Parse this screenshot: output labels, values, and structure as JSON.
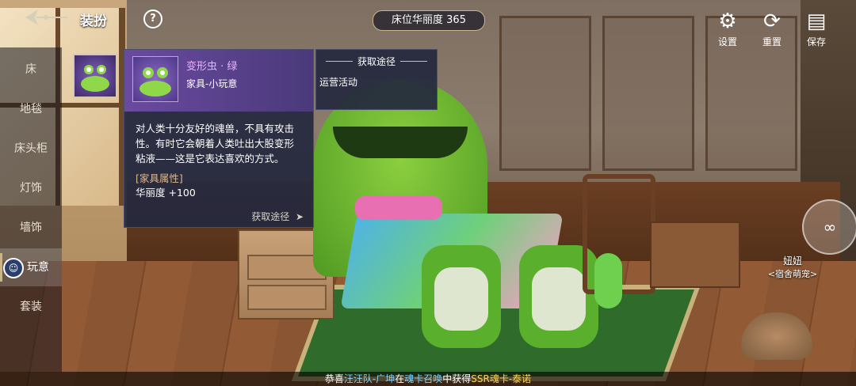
{
  "header": {
    "title": "装扮",
    "help_label": "?",
    "luxury_label": "床位华丽度 365"
  },
  "top_buttons": [
    {
      "label": "设置",
      "icon": "gear-icon"
    },
    {
      "label": "重置",
      "icon": "reset-icon"
    },
    {
      "label": "保存",
      "icon": "save-icon"
    }
  ],
  "sidebar": {
    "items": [
      {
        "label": "床"
      },
      {
        "label": "地毯"
      },
      {
        "label": "床头柜"
      },
      {
        "label": "灯饰"
      },
      {
        "label": "墙饰"
      },
      {
        "label": "玩意"
      },
      {
        "label": "套装"
      }
    ],
    "active_index": 5
  },
  "item_card": {
    "name": "变形虫 · 绿",
    "category": "家具-小玩意",
    "description": "对人类十分友好的魂兽，不具有攻击性。有时它会朝着人类吐出大股变形粘液——这是它表达喜欢的方式。",
    "attr_header": "[家具属性]",
    "attr_line": "华丽度 +100",
    "source_link": "获取途径"
  },
  "source_panel": {
    "title": "获取途径",
    "item": "运营活动"
  },
  "npc": {
    "name": "妞妞",
    "title": "<宿舍萌宠>"
  },
  "ticker": {
    "prefix": "恭喜",
    "team": "汪汪队-广坤",
    "mid1": "在",
    "event": "魂卡召唤",
    "mid2": "中获得",
    "reward": "SSR魂卡-泰诺"
  },
  "colors": {
    "item_name": "#e9b4ff",
    "attr_header": "#e3b783",
    "ticker_name": "#7fd3ff",
    "ticker_reward": "#ffd45a"
  }
}
